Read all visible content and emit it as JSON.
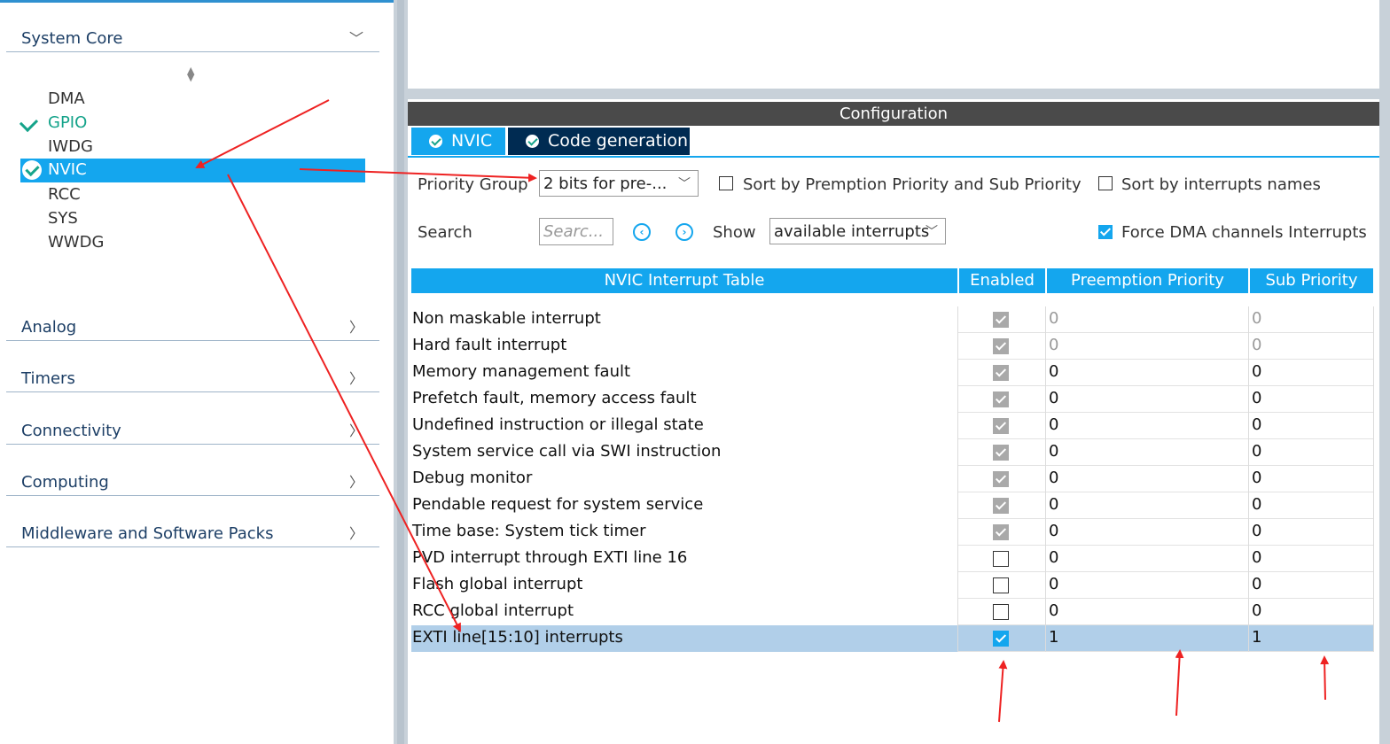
{
  "sidebar": {
    "categories": [
      {
        "label": "System Core",
        "chevron": "chevron-down-icon"
      },
      {
        "label": "Analog",
        "chevron": "chevron-right-icon"
      },
      {
        "label": "Timers",
        "chevron": "chevron-right-icon"
      },
      {
        "label": "Connectivity",
        "chevron": "chevron-right-icon"
      },
      {
        "label": "Computing",
        "chevron": "chevron-right-icon"
      },
      {
        "label": "Middleware and Software Packs",
        "chevron": "chevron-right-icon"
      }
    ],
    "system_core_items": [
      "DMA",
      "GPIO",
      "IWDG",
      "NVIC",
      "RCC",
      "SYS",
      "WWDG"
    ],
    "selected_item": "NVIC"
  },
  "config": {
    "title": "Configuration",
    "tabs": [
      {
        "label": "NVIC"
      },
      {
        "label": "Code generation"
      }
    ],
    "priority_group_label": "Priority Group",
    "priority_group_value": "2 bits for pre-...",
    "sort_premption_label": "Sort by Premption Priority and Sub Priority",
    "sort_premption_checked": false,
    "sort_names_label": "Sort by interrupts names",
    "sort_names_checked": false,
    "search_label": "Search",
    "search_placeholder": "Searc...",
    "show_label": "Show",
    "show_value": "available interrupts",
    "force_dma_label": "Force DMA channels Interrupts",
    "force_dma_checked": true
  },
  "table": {
    "headers": [
      "NVIC Interrupt Table",
      "Enabled",
      "Preemption Priority",
      "Sub Priority"
    ],
    "rows": [
      {
        "name": "Non maskable interrupt",
        "enabled": "locked",
        "preemption": "0",
        "sub": "0",
        "disabled_values": true
      },
      {
        "name": "Hard fault interrupt",
        "enabled": "locked",
        "preemption": "0",
        "sub": "0",
        "disabled_values": true
      },
      {
        "name": "Memory management fault",
        "enabled": "locked",
        "preemption": "0",
        "sub": "0"
      },
      {
        "name": "Prefetch fault, memory access fault",
        "enabled": "locked",
        "preemption": "0",
        "sub": "0"
      },
      {
        "name": "Undefined instruction or illegal state",
        "enabled": "locked",
        "preemption": "0",
        "sub": "0"
      },
      {
        "name": "System service call via SWI instruction",
        "enabled": "locked",
        "preemption": "0",
        "sub": "0"
      },
      {
        "name": "Debug monitor",
        "enabled": "locked",
        "preemption": "0",
        "sub": "0"
      },
      {
        "name": "Pendable request for system service",
        "enabled": "locked",
        "preemption": "0",
        "sub": "0"
      },
      {
        "name": "Time base: System tick timer",
        "enabled": "locked",
        "preemption": "0",
        "sub": "0"
      },
      {
        "name": "PVD interrupt through EXTI line 16",
        "enabled": "off",
        "preemption": "0",
        "sub": "0"
      },
      {
        "name": "Flash global interrupt",
        "enabled": "off",
        "preemption": "0",
        "sub": "0"
      },
      {
        "name": "RCC global interrupt",
        "enabled": "off",
        "preemption": "0",
        "sub": "0"
      },
      {
        "name": "EXTI line[15:10] interrupts",
        "enabled": "on",
        "preemption": "1",
        "sub": "1",
        "selected": true
      }
    ]
  },
  "colors": {
    "accent": "#14a6ee",
    "dark_tab": "#002b52",
    "selection": "#b1cfe9",
    "annotation": "#ee2222"
  }
}
